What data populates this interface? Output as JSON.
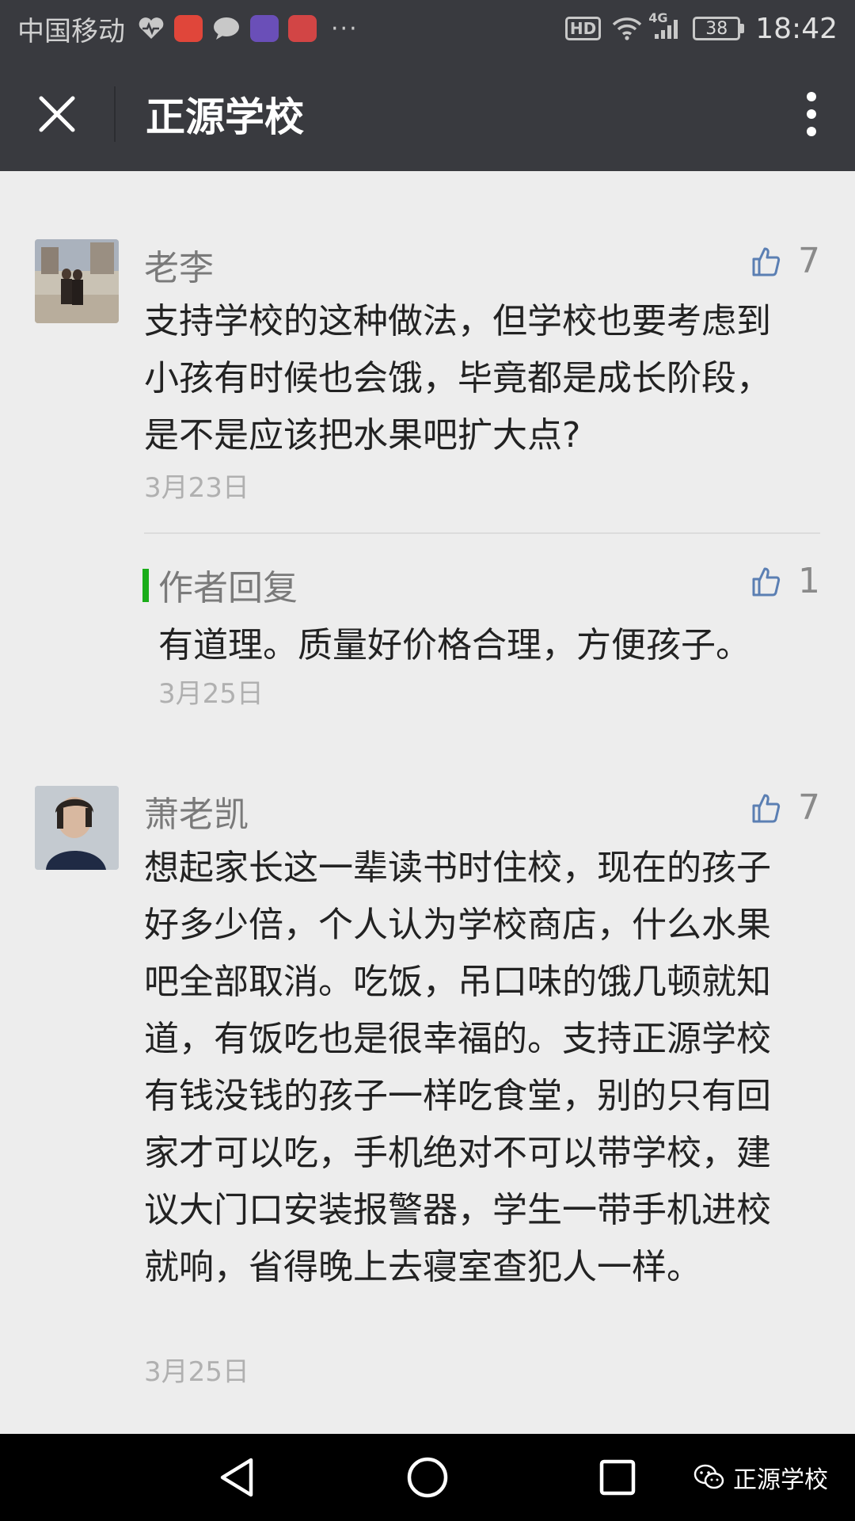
{
  "status_bar": {
    "carrier": "中国移动",
    "more": "···",
    "hd_badge": "HD",
    "network": "4G",
    "battery": "38",
    "time": "18:42"
  },
  "header": {
    "title": "正源学校",
    "close_icon": "close-icon",
    "menu_icon": "more-vertical-icon"
  },
  "comments": [
    {
      "name": "老李",
      "likes": "7",
      "text": "支持学校的这种做法，但学校也要考虑到小孩有时候也会饿，毕竟都是成长阶段，是不是应该把水果吧扩大点?",
      "date": "3月23日",
      "reply": {
        "title": "作者回复",
        "likes": "1",
        "text": "有道理。质量好价格合理，方便孩子。",
        "date": "3月25日"
      }
    },
    {
      "name": "萧老凯",
      "likes": "7",
      "text": "想起家长这一辈读书时住校，现在的孩子好多少倍，个人认为学校商店，什么水果吧全部取消。吃饭，吊口味的饿几顿就知道，有饭吃也是很幸福的。支持正源学校有钱没钱的孩子一样吃食堂，别的只有回家才可以吃，手机绝对不可以带学校，建议大门口安装报警器，学生一带手机进校就响，省得晚上去寝室查犯人一样。",
      "date": "3月25日"
    }
  ],
  "nav_bar": {
    "back_icon": "back-triangle-icon",
    "home_icon": "home-circle-icon",
    "recents_icon": "recents-square-icon",
    "watermark": "正源学校"
  },
  "colors": {
    "bar_bg": "#393a3f",
    "page_bg": "#ededed",
    "reply_accent": "#1aad19",
    "like_icon": "#5b7fb3"
  }
}
